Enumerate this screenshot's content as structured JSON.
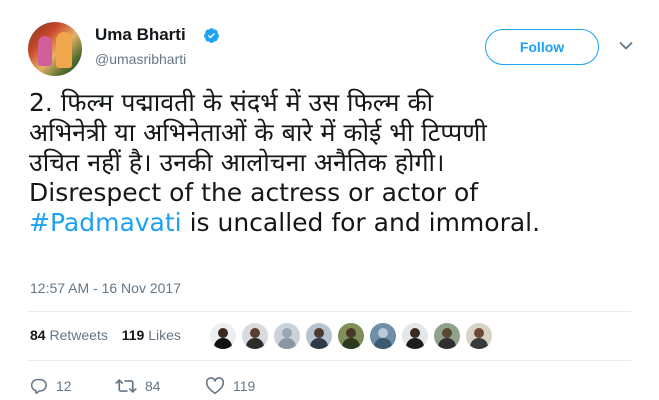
{
  "tweet": {
    "author": {
      "display_name": "Uma Bharti",
      "handle": "@umasribharti",
      "verified": true
    },
    "follow_label": "Follow",
    "text_lines": [
      "2. फिल्म पद्मावती के संदर्भ में उस फिल्म की",
      "अभिनेत्री या अभिनेताओं के बारे में कोई भी टिप्पणी",
      "उचित नहीं है। उनकी आलोचना अनैतिक होगी।",
      "Disrespect of the actress or actor of"
    ],
    "hashtag": "#Padmavati",
    "text_tail": " is uncalled for and immoral.",
    "timestamp": "12:57 AM - 16 Nov 2017",
    "stats": {
      "retweets_count": "84",
      "retweets_label": "Retweets",
      "likes_count": "119",
      "likes_label": "Likes"
    },
    "likers": [
      {
        "name": "liker-avatar-1"
      },
      {
        "name": "liker-avatar-2"
      },
      {
        "name": "liker-avatar-3"
      },
      {
        "name": "liker-avatar-4"
      },
      {
        "name": "liker-avatar-5"
      },
      {
        "name": "liker-avatar-6"
      },
      {
        "name": "liker-avatar-7"
      },
      {
        "name": "liker-avatar-8"
      },
      {
        "name": "liker-avatar-9"
      }
    ],
    "actions": {
      "reply_count": "12",
      "retweet_count": "84",
      "like_count": "119"
    },
    "colors": {
      "accent": "#1da1f2",
      "secondary_text": "#657786",
      "primary_text": "#14171a",
      "divider": "#e6ecf0"
    },
    "icons": {
      "verified": "verified-badge-icon",
      "caret": "chevron-down-icon",
      "reply": "reply-icon",
      "retweet": "retweet-icon",
      "like": "heart-icon"
    }
  }
}
